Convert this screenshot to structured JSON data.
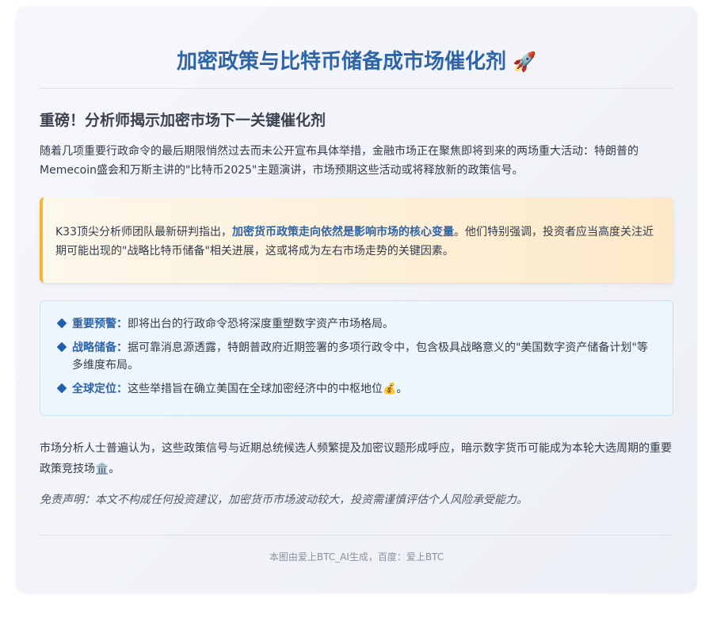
{
  "header": {
    "title": "加密政策与比特币储备成市场催化剂",
    "title_emoji": "🚀"
  },
  "article": {
    "subtitle": "重磅！分析师揭示加密市场下一关键催化剂",
    "intro": "随着几项重要行政命令的最后期限悄然过去而未公开宣布具体举措，金融市场正在聚焦即将到来的两场重大活动：特朗普的Memecoin盛会和万斯主讲的\"比特币2025\"主题演讲，市场预期这些活动或将释放新的政策信号。",
    "quote": {
      "before": "K33顶尖分析师团队最新研判指出，",
      "highlight": "加密货币政策走向依然是影响市场的核心变量",
      "after": "。他们特别强调，投资者应当高度关注近期可能出现的\"战略比特币储备\"相关进展，这或将成为左右市场走势的关键因素。"
    },
    "info_items": [
      {
        "key": "重要预警：",
        "text": "即将出台的行政命令恐将深度重塑数字资产市场格局。"
      },
      {
        "key": "战略储备：",
        "text": "据可靠消息源透露，特朗普政府近期签署的多项行政令中，包含极具战略意义的\"美国数字资产储备计划\"等多维度布局。"
      },
      {
        "key": "全球定位：",
        "text": "这些举措旨在确立美国在全球加密经济中的中枢地位💰。"
      }
    ],
    "conclusion": "市场分析人士普遍认为，这些政策信号与近期总统候选人频繁提及加密议题形成呼应，暗示数字货币可能成为本轮大选周期的重要政策竞技场🏛️。",
    "disclaimer": "免责声明：本文不构成任何投资建议，加密货币市场波动较大，投资需谨慎评估个人风险承受能力。"
  },
  "footer": {
    "credit": "本图由爱上BTC_AI生成，百度：爱上BTC"
  },
  "colors": {
    "accent": "#2e64a8",
    "quote_border": "#f5b731",
    "info_bg": "#eef6fd"
  }
}
